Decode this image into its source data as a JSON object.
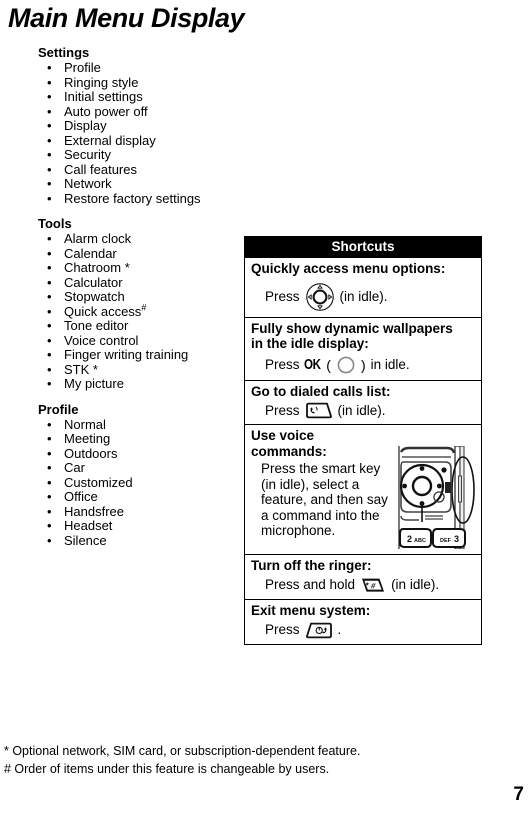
{
  "title": "Main Menu Display",
  "groups": [
    {
      "heading": "Settings",
      "items": [
        {
          "label": "Profile",
          "mark": ""
        },
        {
          "label": "Ringing style",
          "mark": ""
        },
        {
          "label": "Initial settings",
          "mark": ""
        },
        {
          "label": "Auto power off",
          "mark": ""
        },
        {
          "label": "Display",
          "mark": ""
        },
        {
          "label": "External display",
          "mark": ""
        },
        {
          "label": "Security",
          "mark": ""
        },
        {
          "label": "Call features",
          "mark": ""
        },
        {
          "label": "Network",
          "mark": ""
        },
        {
          "label": "Restore factory settings",
          "mark": ""
        }
      ]
    },
    {
      "heading": "Tools",
      "items": [
        {
          "label": "Alarm clock",
          "mark": ""
        },
        {
          "label": "Calendar",
          "mark": ""
        },
        {
          "label": "Chatroom *",
          "mark": ""
        },
        {
          "label": "Calculator",
          "mark": ""
        },
        {
          "label": "Stopwatch",
          "mark": ""
        },
        {
          "label": "Quick access",
          "mark": "#"
        },
        {
          "label": "Tone editor",
          "mark": ""
        },
        {
          "label": "Voice control",
          "mark": ""
        },
        {
          "label": "Finger writing training",
          "mark": ""
        },
        {
          "label": "STK *",
          "mark": ""
        },
        {
          "label": "My picture",
          "mark": ""
        }
      ]
    },
    {
      "heading": "Profile",
      "items": [
        {
          "label": "Normal",
          "mark": ""
        },
        {
          "label": "Meeting",
          "mark": ""
        },
        {
          "label": "Outdoors",
          "mark": ""
        },
        {
          "label": "Car",
          "mark": ""
        },
        {
          "label": "Customized",
          "mark": ""
        },
        {
          "label": "Office",
          "mark": ""
        },
        {
          "label": "Handsfree",
          "mark": ""
        },
        {
          "label": "Headset",
          "mark": ""
        },
        {
          "label": "Silence",
          "mark": ""
        }
      ]
    }
  ],
  "shortcuts": {
    "header": "Shortcuts",
    "rows": {
      "menu_options": {
        "title": "Quickly access menu options:",
        "press_label": "Press",
        "suffix": "(in idle).",
        "icon": "navigation-key-icon"
      },
      "wallpapers": {
        "title_line1": "Fully show dynamic wallpapers",
        "title_line2": "in the idle display:",
        "press_label": "Press",
        "ok_label": "OK",
        "paren_open": "(",
        "paren_close": ")",
        "suffix": "in idle.",
        "icon": "ok-key-icon"
      },
      "dialed_calls": {
        "title": "Go to dialed calls list:",
        "press_label": "Press",
        "suffix": "(in idle).",
        "icon": "send-key-icon"
      },
      "voice_commands": {
        "title_line1": "Use voice",
        "title_line2": "commands:",
        "body": "Press the smart key (in idle), select a feature, and then say a command into the microphone.",
        "photo": "phone-keypad-photo",
        "photo_keys": [
          "2 ABC",
          "DEF 3"
        ]
      },
      "ringer_off": {
        "title": "Turn off the ringer:",
        "press_label": "Press and hold",
        "suffix": "(in idle).",
        "icon": "pound-key-icon"
      },
      "exit_menu": {
        "title": "Exit menu system:",
        "press_label": "Press",
        "suffix": ".",
        "icon": "end-key-icon"
      }
    }
  },
  "footnotes": [
    "* Optional network, SIM card, or subscription-dependent feature.",
    "# Order of items under this feature is changeable by users."
  ],
  "page_number": "7"
}
